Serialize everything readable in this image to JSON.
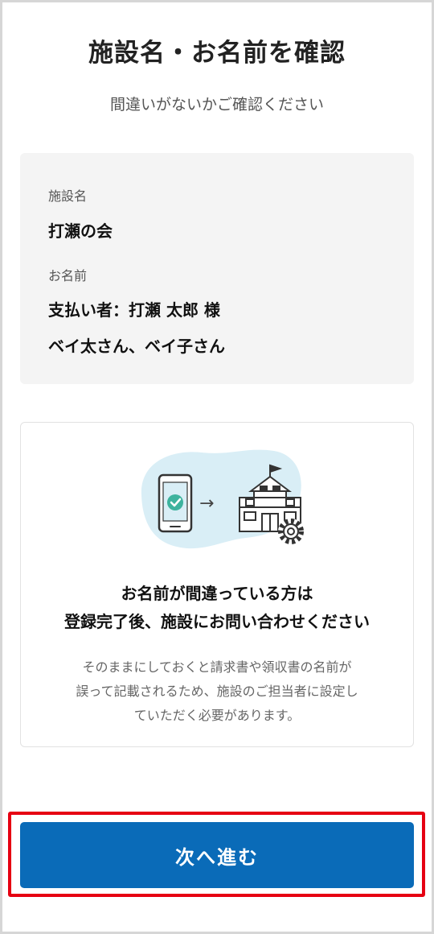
{
  "header": {
    "title": "施設名・お名前を確認",
    "subtitle": "間違いがないかご確認ください"
  },
  "info_card": {
    "facility_label": "施設名",
    "facility_value": "打瀬の会",
    "name_label": "お名前",
    "name_lines": [
      "支払い者：打瀬 太郎 様",
      "ベイ太さん、ベイ子さん"
    ]
  },
  "notice_card": {
    "illustration": {
      "icons": [
        "smartphone-check-icon",
        "arrow-right-icon",
        "school-building-icon",
        "gear-icon"
      ],
      "arrow_glyph": "→",
      "blob_color": "#d9eef6"
    },
    "heading_lines": [
      "お名前が間違っている方は",
      "登録完了後、施設にお問い合わせください"
    ],
    "body_lines": [
      "そのままにしておくと請求書や領収書の名前が",
      "誤って記載されるため、施設のご担当者に設定し",
      "ていただく必要があります。"
    ]
  },
  "footer": {
    "next_button_label": "次へ進む"
  },
  "colors": {
    "primary_button": "#0a6bb8",
    "highlight_border": "#e60012",
    "info_card_bg": "#f4f4f4",
    "check_green": "#3db39e"
  }
}
